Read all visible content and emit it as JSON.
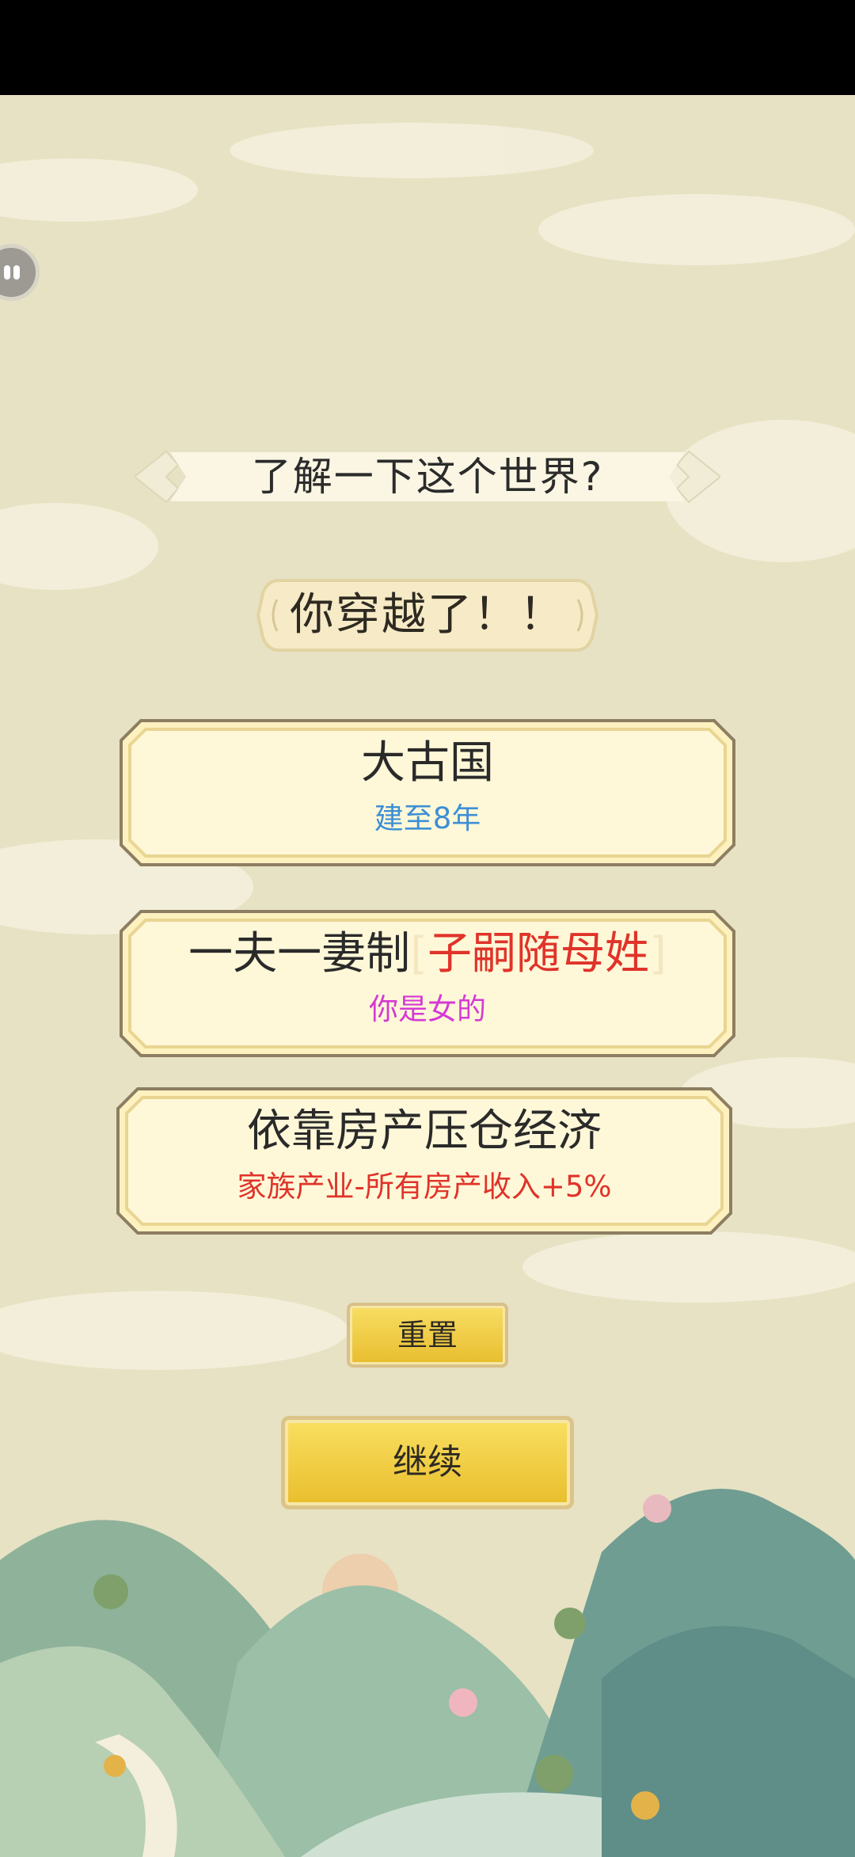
{
  "header": {
    "title": "了解一下这个世界?"
  },
  "intro": {
    "text": "你穿越了！！"
  },
  "cards": [
    {
      "title": "大古国",
      "subtitle": "建至8年",
      "subtitle_color": "#3d8fd6"
    },
    {
      "title_main": "一夫一妻制",
      "bracket_open": "[",
      "title_highlight": "子嗣随母姓",
      "bracket_close": "]",
      "subtitle": "你是女的",
      "subtitle_color": "#d43ad4"
    },
    {
      "title": "依靠房产压仓经济",
      "subtitle": "家族产业-所有房产收入+5%",
      "subtitle_color": "#e0332a"
    }
  ],
  "buttons": {
    "reset": "重置",
    "continue": "继续"
  },
  "icons": {
    "avatar": "avatar-icon"
  },
  "colors": {
    "card_fill": "#fdf3c6",
    "card_border": "#8a7b5f",
    "button_gold": "#f2cf45",
    "background": "#e6e1c3"
  }
}
